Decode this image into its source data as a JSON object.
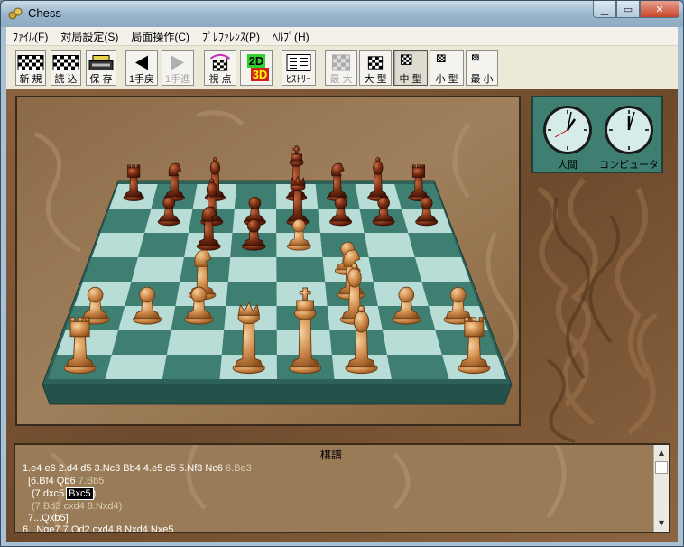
{
  "window": {
    "title": "Chess"
  },
  "menu": [
    "ﾌｧｲﾙ(F)",
    "対局設定(S)",
    "局面操作(C)",
    "ﾌﾟﾚﾌｧﾚﾝｽ(P)",
    "ﾍﾙﾌﾟ(H)"
  ],
  "toolbar": {
    "new": "新 規",
    "load": "読 込",
    "save": "保 存",
    "undo": "1手戻",
    "redo": "1手進",
    "viewpoint": "視 点",
    "view2d": "2D",
    "view3d": "3D",
    "history": "ﾋｽﾄﾘｰ",
    "max": "最 大",
    "large": "大 型",
    "medium": "中 型",
    "small": "小 型",
    "min": "最 小"
  },
  "clocks": {
    "human_label": "人間",
    "computer_label": "コンピュータ"
  },
  "kifu": {
    "title": "棋譜",
    "line1_main": "1.e4 e6 2.d4 d5 3.Nc3 Bb4 4.e5 c5 5.Nf3 Nc6",
    "line1_dim": "6.Be3",
    "line2_open": "[6.Bf4 Qb6",
    "line2_dim": "7.Bb5",
    "line3_open": "(7.dxc5",
    "line3_hl": "Bxc5",
    "line3_close": ")",
    "line4": "(7.Bd3 cxd4 8.Nxd4)",
    "line5": "7...Qxb5]",
    "line6": "6...Nge7 7.Qd2 cxd4 8.Nxd4 Nxe5"
  },
  "colors": {
    "board_light": "#b8dcd6",
    "board_dark": "#3f7f72",
    "board_edge": "#2e6158",
    "wood_bg": "#7a5535",
    "piece_dark": "#6b2a14",
    "piece_light": "#c98a4c"
  },
  "icons": {
    "new": "checkered-board-icon",
    "load": "checkered-board-icon",
    "save": "cash-register-icon",
    "undo": "triangle-left-icon",
    "redo": "triangle-right-icon",
    "viewpoint": "rotate-board-icon",
    "view": "2d-3d-icon",
    "history": "move-list-icon"
  }
}
